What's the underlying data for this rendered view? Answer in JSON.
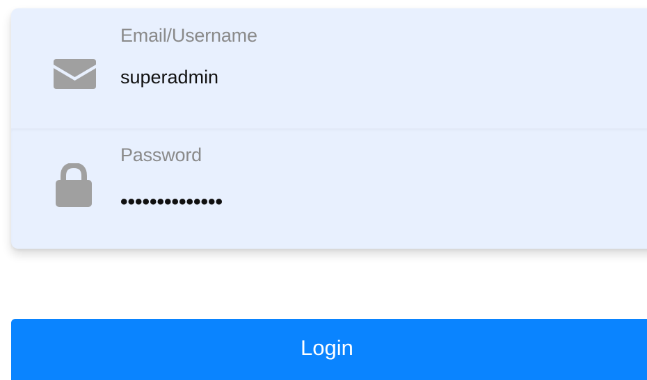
{
  "form": {
    "email": {
      "label": "Email/Username",
      "value": "superadmin",
      "icon": "envelope-icon"
    },
    "password": {
      "label": "Password",
      "value": "••••••••••••••",
      "icon": "lock-icon"
    },
    "login_label": "Login"
  },
  "colors": {
    "field_background": "#e8f0fe",
    "icon": "#a0a0a0",
    "label": "#8a8a8a",
    "value": "#111111",
    "button": "#0a84ff",
    "button_text": "#ffffff"
  }
}
